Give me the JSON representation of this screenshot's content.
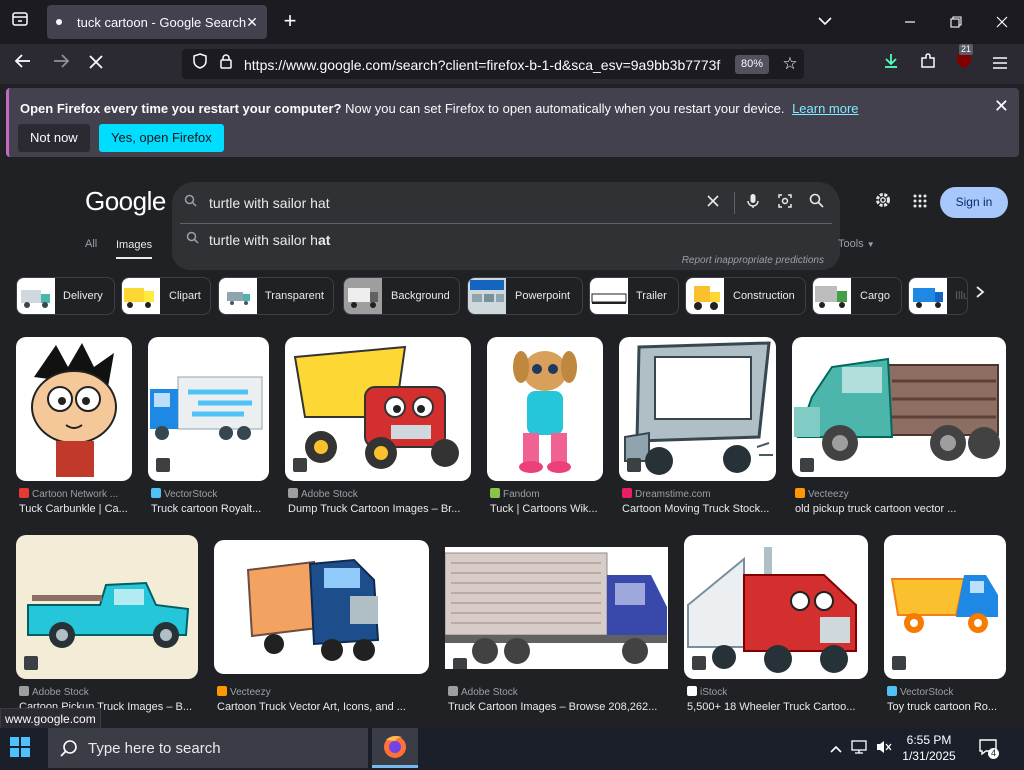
{
  "browser": {
    "tab_title": "tuck cartoon - Google Search",
    "url": "https://www.google.com/search?client=firefox-b-1-d&sca_esv=9a9bb3b7773f",
    "zoom": "80%",
    "extension_badge": "21"
  },
  "notification": {
    "bold": "Open Firefox every time you restart your computer?",
    "text": "Now you can set Firefox to open automatically when you restart your device.",
    "link": "Learn more",
    "not_now": "Not now",
    "yes": "Yes, open Firefox"
  },
  "google": {
    "logo": "Google",
    "query": "turtle with sailor hat",
    "suggestion_prefix": "turtle with sailor h",
    "suggestion_bold": "at",
    "report": "Report inappropriate predictions",
    "sign_in": "Sign in",
    "tab_all": "All",
    "tab_images": "Images",
    "tools": "Tools"
  },
  "chips": [
    {
      "label": "Delivery"
    },
    {
      "label": "Clipart"
    },
    {
      "label": "Transparent"
    },
    {
      "label": "Background"
    },
    {
      "label": "Powerpoint"
    },
    {
      "label": "Trailer"
    },
    {
      "label": "Construction"
    },
    {
      "label": "Cargo"
    },
    {
      "label": "Illu"
    }
  ],
  "results": [
    {
      "source": "Cartoon Network ...",
      "title": "Tuck Carbunkle | Ca...",
      "src_color": "#e53935"
    },
    {
      "source": "VectorStock",
      "title": "Truck cartoon Royalt...",
      "src_color": "#4fc3f7"
    },
    {
      "source": "Adobe Stock",
      "title": "Dump Truck Cartoon Images – Br...",
      "src_color": "#9e9e9e"
    },
    {
      "source": "Fandom",
      "title": "Tuck | Cartoons Wik...",
      "src_color": "#8bc34a"
    },
    {
      "source": "Dreamstime.com",
      "title": "Cartoon Moving Truck Stock...",
      "src_color": "#e91e63"
    },
    {
      "source": "Vecteezy",
      "title": "old pickup truck cartoon vector ...",
      "src_color": "#ff9800"
    },
    {
      "source": "Adobe Stock",
      "title": "Cartoon Pickup Truck Images – B...",
      "src_color": "#9e9e9e"
    },
    {
      "source": "Vecteezy",
      "title": "Cartoon Truck Vector Art, Icons, and ...",
      "src_color": "#ff9800"
    },
    {
      "source": "Adobe Stock",
      "title": "Truck Cartoon Images – Browse 208,262...",
      "src_color": "#9e9e9e"
    },
    {
      "source": "iStock",
      "title": "5,500+ 18 Wheeler Truck Cartoo...",
      "src_color": "#ffffff"
    },
    {
      "source": "VectorStock",
      "title": "Toy truck cartoon Ro...",
      "src_color": "#4fc3f7"
    }
  ],
  "status_url": "www.google.com",
  "taskbar": {
    "search_placeholder": "Type here to search",
    "time": "6:55 PM",
    "date": "1/31/2025",
    "notifications": "4"
  }
}
